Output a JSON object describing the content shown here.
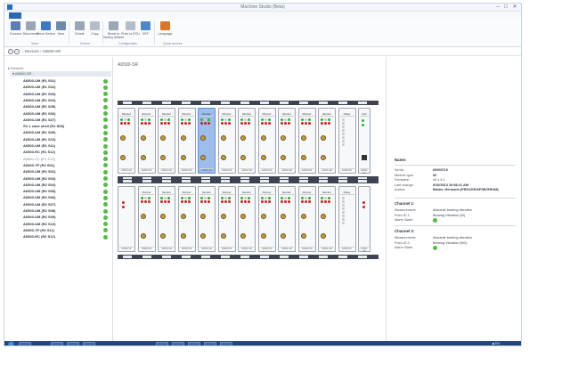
{
  "window": {
    "title": "Machine Studio (Beta)",
    "controls": {
      "minimize": "–",
      "maximize": "□",
      "close": "✕"
    }
  },
  "ribbon": {
    "buttons": [
      {
        "id": "connect",
        "label": "Connect",
        "icon": "connect-icon",
        "color": "#5b7fb4"
      },
      {
        "id": "disconnect",
        "label": "Disconnect",
        "icon": "disconnect-icon",
        "color": "#9aa6b3"
      },
      {
        "id": "move-device",
        "label": "Move Device",
        "icon": "move-icon",
        "color": "#3e78c2"
      },
      {
        "id": "new",
        "label": "New",
        "icon": "new-rack-icon",
        "color": "#6f8aa8"
      },
      {
        "id": "delete",
        "label": "Delete",
        "icon": "delete-icon",
        "color": "#9aa6b3"
      },
      {
        "id": "copy",
        "label": "Copy",
        "icon": "copy-icon",
        "color": "#b5bec8"
      },
      {
        "id": "reset-factory",
        "label": "Reset to factory default",
        "icon": "reset-icon",
        "color": "#9aa6b3"
      },
      {
        "id": "push-to-ecu",
        "label": "Push to ECU",
        "icon": "push-icon",
        "color": "#b5bec8"
      },
      {
        "id": "kef",
        "label": "KEF",
        "icon": "kef-icon",
        "color": "#4d86c9"
      },
      {
        "id": "language",
        "label": "Language",
        "icon": "language-icon",
        "color": "#d9762c"
      }
    ],
    "groups": [
      "View",
      "Device",
      "Configuration",
      "Quick access"
    ]
  },
  "address": {
    "back_icon": "back-arrow-icon",
    "forward_icon": "forward-arrow-icon",
    "breadcrumb": "› Devices › A6500-SR"
  },
  "sidebar": {
    "root_label": "▸ Devices",
    "rack_label": "▾ A6500-SR",
    "items": [
      {
        "label": "A6500-UM (R1 S01)",
        "dim": false
      },
      {
        "label": "A6500-UM (R1 S02)",
        "dim": false
      },
      {
        "label": "A6500-UM (R1 S03)",
        "dim": false
      },
      {
        "label": "A6500-UM (R1 S04)",
        "dim": false
      },
      {
        "label": "A6500-UM (R1 S05)",
        "dim": false
      },
      {
        "label": "A6500-UM (R1 S06)",
        "dim": false
      },
      {
        "label": "A6500-UM (R1 S07)",
        "dim": false
      },
      {
        "label": "SV 1 case shell (R1 S08)",
        "dim": false
      },
      {
        "label": "A6500-UM (R1 S09)",
        "dim": false
      },
      {
        "label": "A6500-UM (R1 S10)",
        "dim": false
      },
      {
        "label": "A6500-UM (R1 S11)",
        "dim": false
      },
      {
        "label": "A6500-RC (R1 S12)",
        "dim": false
      },
      {
        "label": "A6500-CC (R1 S13)",
        "dim": true
      },
      {
        "label": "A6500-TP (R2 S01)",
        "dim": false
      },
      {
        "label": "A6500-UM (R2 S02)",
        "dim": false
      },
      {
        "label": "A6500-UM (R2 S03)",
        "dim": false
      },
      {
        "label": "A6500-UM (R2 S04)",
        "dim": false
      },
      {
        "label": "A6500-UM (R2 S05)",
        "dim": false
      },
      {
        "label": "A6500-UM (R2 S06)",
        "dim": false
      },
      {
        "label": "A6500-UM (R2 S07)",
        "dim": false
      },
      {
        "label": "A6500-UM (R2 S08)",
        "dim": false
      },
      {
        "label": "A6500-UM (R2 S09)",
        "dim": false
      },
      {
        "label": "A6500-UM (R2 S10)",
        "dim": false
      },
      {
        "label": "A6500-TP (R2 S11)",
        "dim": false
      },
      {
        "label": "A6500-RC (R2 S12)",
        "dim": false
      }
    ]
  },
  "main": {
    "title": "A6500-SR",
    "rack1": {
      "modules": [
        {
          "head": "Monitor",
          "foot": "A6500-UM",
          "selected": false,
          "type": "um"
        },
        {
          "head": "Monitor",
          "foot": "A6500-UM",
          "selected": false,
          "type": "um"
        },
        {
          "head": "Monitor",
          "foot": "A6500-UM",
          "selected": false,
          "type": "um"
        },
        {
          "head": "Monitor",
          "foot": "A6500-UM",
          "selected": false,
          "type": "um"
        },
        {
          "head": "Monitor",
          "foot": "A6500-UM",
          "selected": true,
          "type": "um"
        },
        {
          "head": "Monitor",
          "foot": "A6500-UM",
          "selected": false,
          "type": "um"
        },
        {
          "head": "Monitor",
          "foot": "A6500-UM",
          "selected": false,
          "type": "um"
        },
        {
          "head": "Monitor",
          "foot": "A6500-UM",
          "selected": false,
          "type": "um"
        },
        {
          "head": "Monitor",
          "foot": "A6500-UM",
          "selected": false,
          "type": "um"
        },
        {
          "head": "Monitor",
          "foot": "A6500-UM",
          "selected": false,
          "type": "um"
        },
        {
          "head": "Monitor",
          "foot": "A6500-UM",
          "selected": false,
          "type": "um"
        },
        {
          "head": "Relay",
          "foot": "A6500-RC",
          "selected": false,
          "type": "rc"
        },
        {
          "head": "Com",
          "foot": "A6500-CC",
          "selected": false,
          "type": "cc"
        }
      ]
    },
    "rack2": {
      "modules": [
        {
          "head": "",
          "foot": "A6500-TP",
          "selected": false,
          "type": "tp"
        },
        {
          "head": "Monitor",
          "foot": "A6500-UM",
          "selected": false,
          "type": "um"
        },
        {
          "head": "Monitor",
          "foot": "A6500-UM",
          "selected": false,
          "type": "um"
        },
        {
          "head": "Monitor",
          "foot": "A6500-UM",
          "selected": false,
          "type": "um"
        },
        {
          "head": "Monitor",
          "foot": "A6500-UM",
          "selected": false,
          "type": "um"
        },
        {
          "head": "Monitor",
          "foot": "A6500-UM",
          "selected": false,
          "type": "um"
        },
        {
          "head": "Monitor",
          "foot": "A6500-UM",
          "selected": false,
          "type": "um"
        },
        {
          "head": "Monitor",
          "foot": "A6500-UM",
          "selected": false,
          "type": "um"
        },
        {
          "head": "Monitor",
          "foot": "A6500-UM",
          "selected": false,
          "type": "um"
        },
        {
          "head": "Monitor",
          "foot": "A6500-UM",
          "selected": false,
          "type": "um"
        },
        {
          "head": "Monitor",
          "foot": "A6500-UM",
          "selected": false,
          "type": "um"
        },
        {
          "head": "Relay",
          "foot": "A6500-RC",
          "selected": false,
          "type": "rc"
        },
        {
          "head": "",
          "foot": "A6500-TP",
          "selected": false,
          "type": "tp"
        }
      ]
    }
  },
  "props": {
    "name_label": "Name:",
    "rows": [
      {
        "k": "Serial:",
        "v": "00000710",
        "bold": true
      },
      {
        "k": "Module type:",
        "v": "00",
        "bold": true
      },
      {
        "k": "Firmware:",
        "v": "v0.1.3.1",
        "bold": false
      },
      {
        "k": "Last change:",
        "v": "9/10/2013 10:58:21 AM",
        "bold": true
      },
      {
        "k": "Author:",
        "v": "Basler, Hermann (PROCESS/PSE/GROM)",
        "bold": true
      }
    ],
    "channel1": {
      "title": "Channel 1:",
      "rows": [
        {
          "k": "Measurement:",
          "v": "Absolute bearing vibration"
        },
        {
          "k": "Point ID 1:",
          "v": "Bearing Vibration (W)"
        },
        {
          "k": "Alarm State:",
          "v": ""
        }
      ]
    },
    "channel2": {
      "title": "Channel 2:",
      "rows": [
        {
          "k": "Measurement:",
          "v": "Absolute bearing vibration"
        },
        {
          "k": "Point ID 2:",
          "v": "Bearing Vibration (W2)"
        },
        {
          "k": "Alarm State:",
          "v": ""
        }
      ]
    }
  },
  "taskbar": {
    "tray_text": "◆ EN"
  }
}
